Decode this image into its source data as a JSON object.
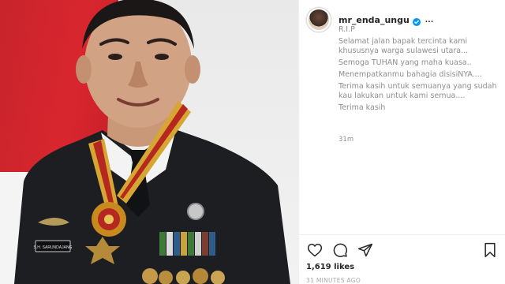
{
  "post": {
    "username": "mr_enda_ungu",
    "more_label": "...",
    "caption_lines": [
      "R.I.P",
      "Selamat jalan bapak tercinta kami khususnya warga sulawesi utara...",
      "Semoga TUHAN yang maha kuasa..",
      "Menempatkanmu bahagia disisiNYA....",
      "Terima kasih untuk semuanya yang sudah kau lakukan untuk kami semua....",
      "Terima kasih"
    ],
    "time_ago": "31m",
    "likes": "1,619 likes",
    "timestamp": "31 MINUTES AGO"
  },
  "photo": {
    "name_tag": "S.H. SARUNDAJANG"
  },
  "icons": {
    "verified": "verified-badge-icon",
    "like": "heart-icon",
    "comment": "comment-icon",
    "share": "paper-plane-icon",
    "save": "bookmark-icon"
  },
  "colors": {
    "verified_blue": "#0095f6",
    "text_primary": "#262626",
    "text_secondary": "#8e8e8e",
    "flag_red": "#d9262e"
  }
}
